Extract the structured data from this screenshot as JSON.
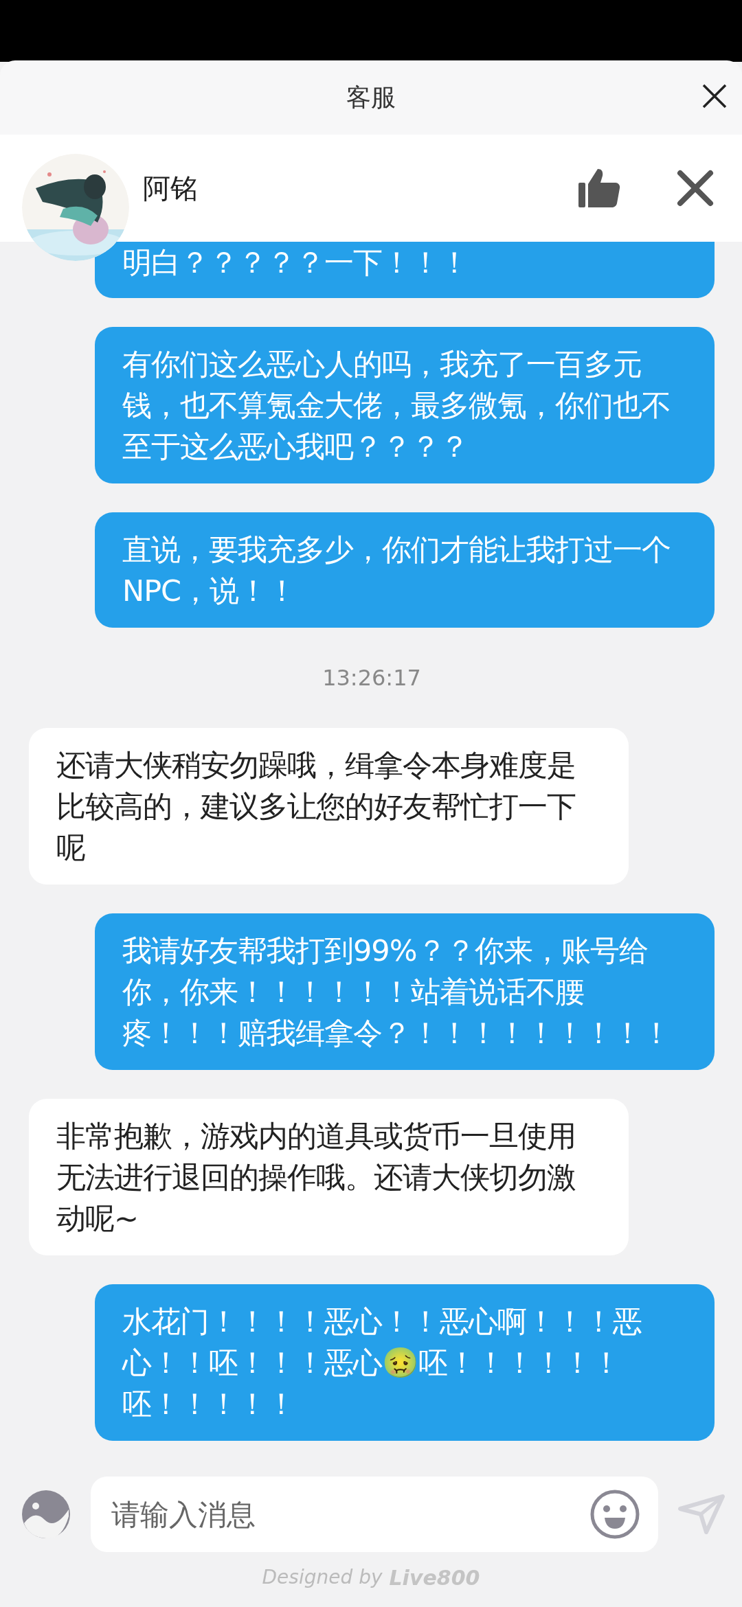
{
  "header": {
    "title": "客服"
  },
  "agent": {
    "name": "阿铭"
  },
  "messages": [
    {
      "kind": "sent",
      "text": "明白？？？？？一下！！！"
    },
    {
      "kind": "sent",
      "text": "有你们这么恶心人的吗，我充了一百多元钱，也不算氪金大佬，最多微氪，你们也不至于这么恶心我吧？？？？"
    },
    {
      "kind": "sent",
      "text": "直说，要我充多少，你们才能让我打过一个NPC，说！！"
    },
    {
      "kind": "time",
      "text": "13:26:17"
    },
    {
      "kind": "received",
      "text": "还请大侠稍安勿躁哦，缉拿令本身难度是比较高的，建议多让您的好友帮忙打一下呢"
    },
    {
      "kind": "sent",
      "text": "我请好友帮我打到99%？？你来，账号给你，你来！！！！！！站着说话不腰疼！！！赔我缉拿令？！！！！！！！！！"
    },
    {
      "kind": "received",
      "text": "非常抱歉，游戏内的道具或货币一旦使用无法进行退回的操作哦。还请大侠切勿激动呢~"
    },
    {
      "kind": "sent",
      "text": "水花门！！！！恶心！！恶心啊！！！恶心！！呸！！！恶心🤢呸！！！！！！呸！！！！！"
    }
  ],
  "input": {
    "placeholder": "请输入消息"
  },
  "footer": {
    "prefix": "Designed by",
    "brand": "Live800"
  }
}
